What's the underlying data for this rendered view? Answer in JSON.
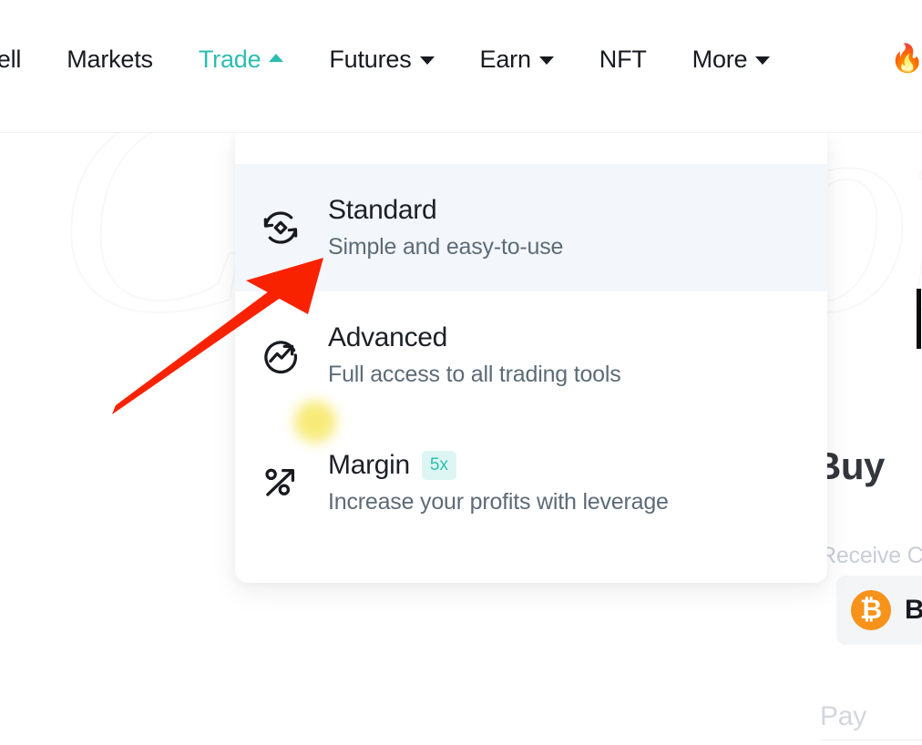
{
  "watermark": {
    "text": "CoinLore"
  },
  "navbar": {
    "items": [
      {
        "label": "Sell",
        "icon": "none",
        "active": false
      },
      {
        "label": "Markets",
        "icon": "none",
        "active": false
      },
      {
        "label": "Trade",
        "icon": "chevron-up-icon",
        "active": true
      },
      {
        "label": "Futures",
        "icon": "chevron-down-icon",
        "active": false
      },
      {
        "label": "Earn",
        "icon": "chevron-down-icon",
        "active": false
      },
      {
        "label": "NFT",
        "icon": "none",
        "active": false
      },
      {
        "label": "More",
        "icon": "chevron-down-icon",
        "active": false
      }
    ],
    "fire_icon": "fire-icon",
    "fire_glyph": "🔥",
    "active_color": "#2ebdb0",
    "text_color": "#181a20"
  },
  "dropdown": {
    "name": "trade-dropdown",
    "items": [
      {
        "title": "Standard",
        "subtitle": "Simple and easy-to-use",
        "icon": "swap-circle-icon",
        "badge": "",
        "highlighted": true
      },
      {
        "title": "Advanced",
        "subtitle": "Full access to all trading tools",
        "icon": "trend-up-circle-icon",
        "badge": "",
        "highlighted": false
      },
      {
        "title": "Margin",
        "subtitle": "Increase your profits with leverage",
        "icon": "percent-arrow-icon",
        "badge": "5x",
        "highlighted": false
      }
    ],
    "highlight_color": "#f3f7fb",
    "badge_bg": "#ddf6f3",
    "badge_color": "#2ebdb0"
  },
  "annotation": {
    "arrow_color": "#f92200",
    "arrow_name": "red-pointer-arrow",
    "glow_color": "#f7e96e"
  },
  "right_panel": {
    "heading": "Buy",
    "receive_label": "Receive C",
    "asset_symbol": "B",
    "asset_icon": "bitcoin-icon",
    "asset_glyph": "₿",
    "pay_label": "Pay",
    "bitcoin_color": "#f7931a"
  }
}
